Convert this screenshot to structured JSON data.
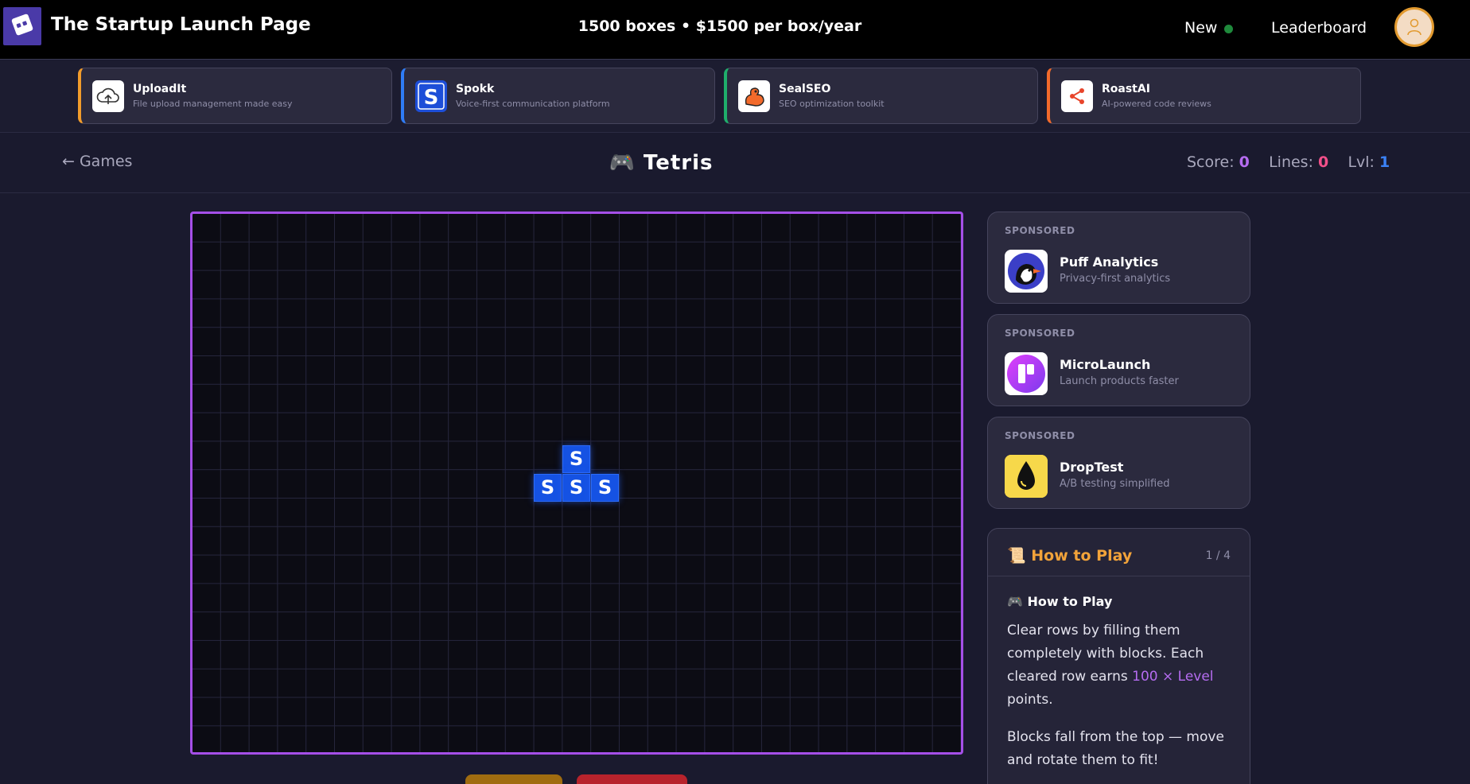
{
  "header": {
    "site_title": "The Startup Launch Page",
    "tagline": "1500 boxes • $1500 per box/year",
    "nav_new": "New",
    "nav_leaderboard": "Leaderboard"
  },
  "featured": [
    {
      "name": "UploadIt",
      "desc": "File upload management made easy",
      "accent": "#f29c2b"
    },
    {
      "name": "Spokk",
      "desc": "Voice-first communication platform",
      "accent": "#2f7cf6"
    },
    {
      "name": "SealSEO",
      "desc": "SEO optimization toolkit",
      "accent": "#1fae6b"
    },
    {
      "name": "RoastAI",
      "desc": "AI-powered code reviews",
      "accent": "#f26a2b"
    }
  ],
  "game": {
    "back_label": "← Games",
    "title": "Tetris",
    "score_label": "Score:",
    "score": "0",
    "lines_label": "Lines:",
    "lines": "0",
    "level_label": "Lvl:",
    "level": "1",
    "block_letter": "S"
  },
  "sponsored": [
    {
      "label": "SPONSORED",
      "name": "Puff Analytics",
      "desc": "Privacy-first analytics"
    },
    {
      "label": "SPONSORED",
      "name": "MicroLaunch",
      "desc": "Launch products faster"
    },
    {
      "label": "SPONSORED",
      "name": "DropTest",
      "desc": "A/B testing simplified"
    }
  ],
  "how_to_play": {
    "title": "How to Play",
    "page": "1 / 4",
    "subtitle": "How to Play",
    "body_1a": "Clear rows by filling them completely with blocks. Each cleared row earns ",
    "body_1b": "100 × Level",
    "body_1c": " points.",
    "body_2": "Blocks fall from the top — move and rotate them to fit!"
  },
  "colors": {
    "accent_purple": "#a54fe8",
    "score_color": "#b56cf0",
    "lines_color": "#f2508a",
    "level_color": "#3b82f6",
    "howto_title": "#f2a33a"
  }
}
